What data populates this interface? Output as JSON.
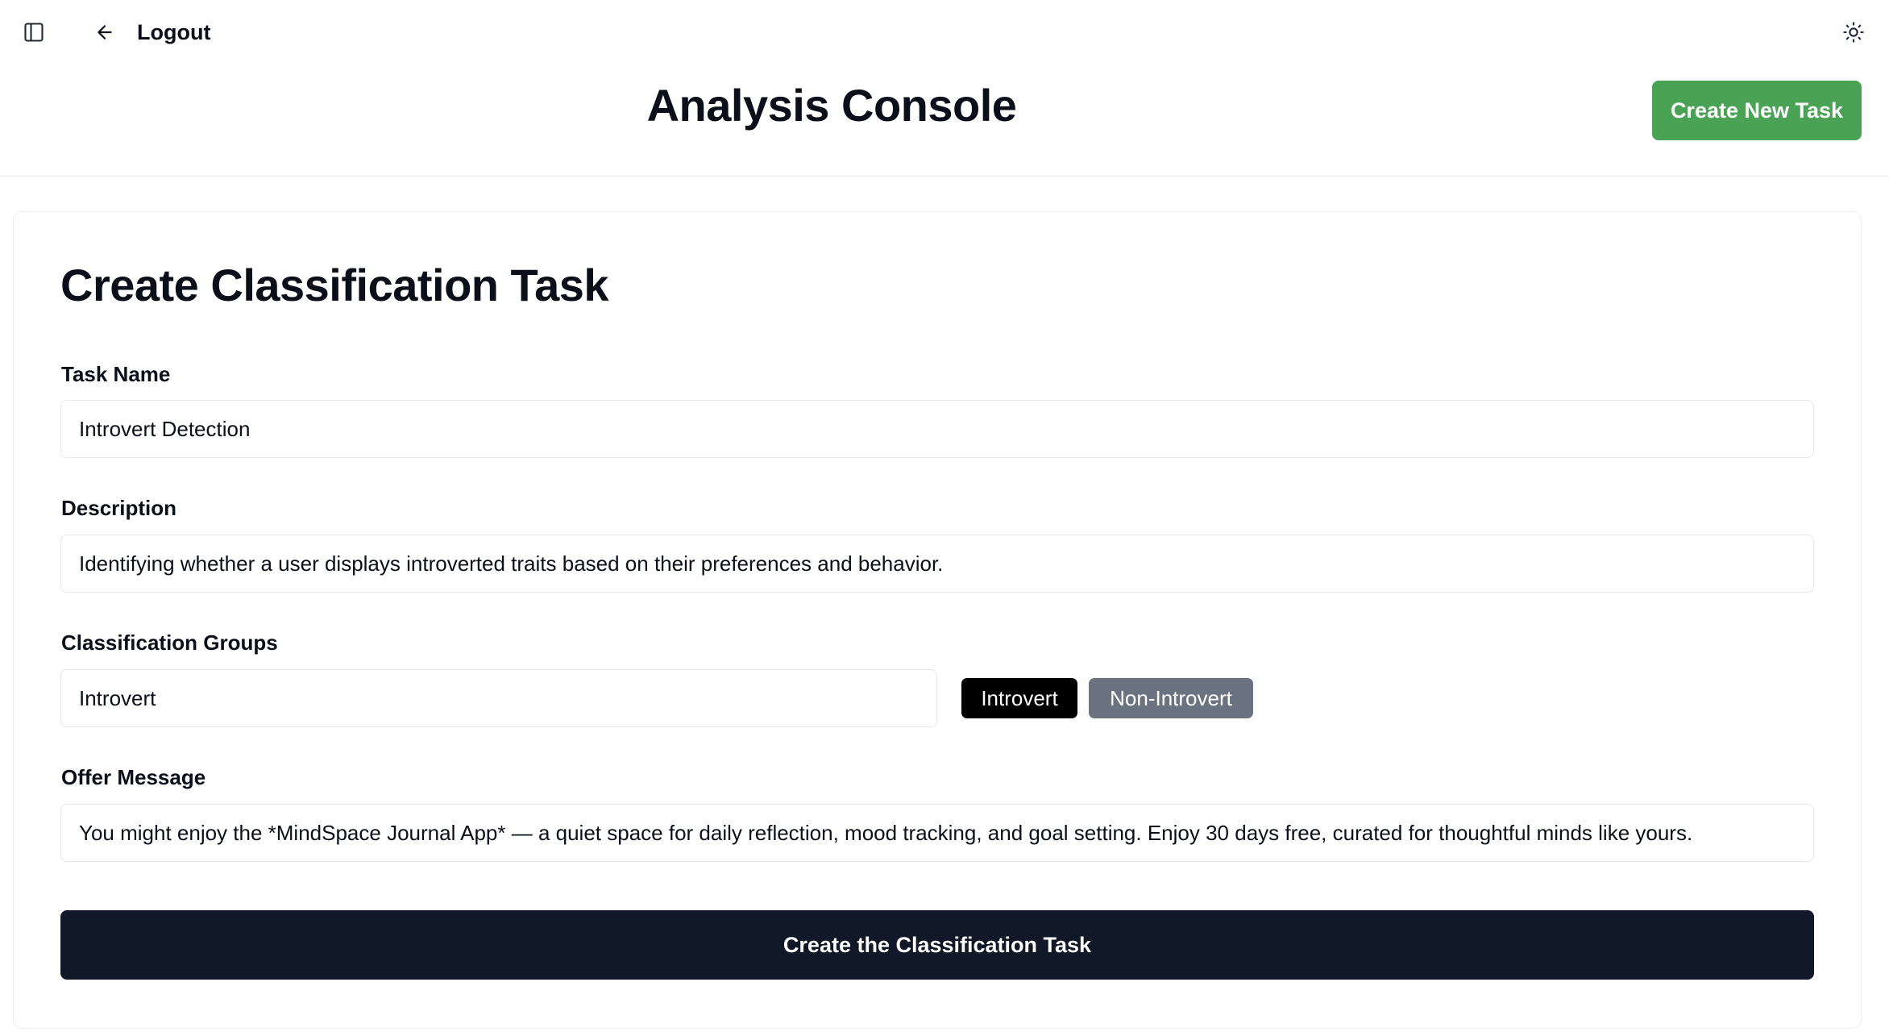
{
  "topbar": {
    "sidebar_toggle_icon": "sidebar-panel-icon",
    "back_icon": "arrow-left-icon",
    "logout_label": "Logout",
    "theme_icon": "sun-icon"
  },
  "header": {
    "title": "Analysis Console",
    "create_new_label": "Create New Task",
    "create_new_color": "#4aa355"
  },
  "form": {
    "title": "Create Classification Task",
    "task_name": {
      "label": "Task Name",
      "value": "Introvert Detection"
    },
    "description": {
      "label": "Description",
      "value": "Identifying whether a user displays introverted traits based on their preferences and behavior."
    },
    "groups": {
      "label": "Classification Groups",
      "value": "Introvert",
      "tags": [
        {
          "label": "Introvert",
          "selected": true,
          "color": "#000000"
        },
        {
          "label": "Non-Introvert",
          "selected": false,
          "color": "#6b7280"
        }
      ]
    },
    "offer": {
      "label": "Offer Message",
      "value": "You might enjoy the *MindSpace Journal App* — a quiet space for daily reflection, mood tracking, and goal setting. Enjoy 30 days free, curated for thoughtful minds like yours."
    },
    "submit_label": "Create the Classification Task",
    "submit_color": "#111827"
  }
}
